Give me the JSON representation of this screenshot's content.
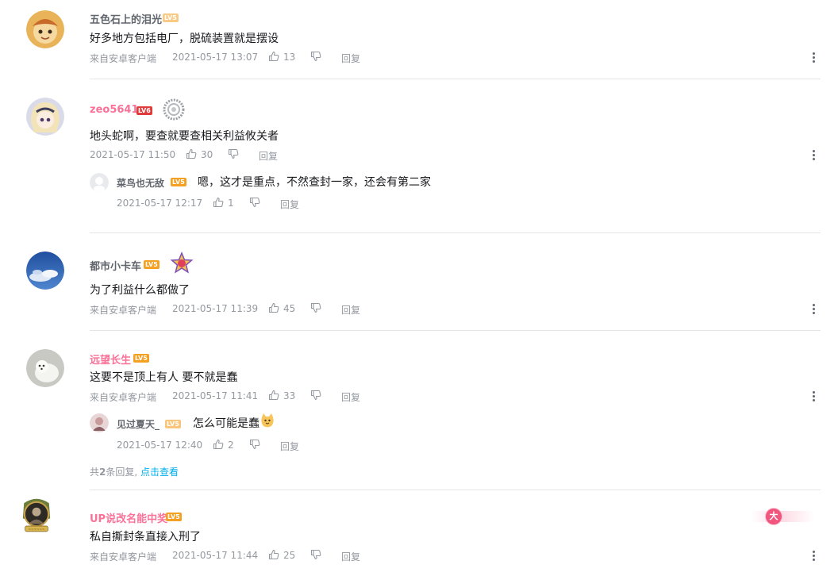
{
  "comments": [
    {
      "username": "五色石上的泪光",
      "level": "LV5",
      "text": "好多地方包括电厂，脱硫装置就是摆设",
      "source": "来自安卓客户端",
      "time": "2021-05-17 13:07",
      "likes": "13",
      "reply_label": "回复"
    },
    {
      "username": "zeo5641",
      "level": "LV6",
      "text": "地头蛇啊，要查就要查相关利益攸关者",
      "source": "",
      "time": "2021-05-17 11:50",
      "likes": "30",
      "reply_label": "回复",
      "sub_replies": [
        {
          "username": "菜鸟也无敌",
          "level": "LV5",
          "text": "嗯，这才是重点，不然查封一家，还会有第二家",
          "time": "2021-05-17 12:17",
          "likes": "1",
          "reply_label": "回复"
        }
      ]
    },
    {
      "username": "都市小卡车",
      "level": "LV5",
      "text": "为了利益什么都做了",
      "source": "来自安卓客户端",
      "time": "2021-05-17 11:39",
      "likes": "45",
      "reply_label": "回复"
    },
    {
      "username": "远望长生",
      "level": "LV5",
      "text": "这要不是顶上有人 要不就是蠢",
      "source": "来自安卓客户端",
      "time": "2021-05-17 11:41",
      "likes": "33",
      "reply_label": "回复",
      "sub_replies": [
        {
          "username": "见过夏天_",
          "level": "LV5",
          "text": "怎么可能是蠢",
          "time": "2021-05-17 12:40",
          "likes": "2",
          "reply_label": "回复"
        }
      ],
      "reply_summary_prefix": "共",
      "reply_summary_count": "2",
      "reply_summary_suffix": "条回复,",
      "reply_summary_link": "点击查看"
    },
    {
      "username": "UP说改名能中奖",
      "level": "LV5",
      "text": "私自撕封条直接入刑了",
      "source": "来自安卓客户端",
      "time": "2021-05-17 11:44",
      "likes": "25",
      "reply_label": "回复",
      "decoration_text": "大"
    }
  ],
  "colors": {
    "username_pink": "#fb7299",
    "username_default": "#61666d",
    "link_blue": "#00aeec",
    "level5": "#f4a023",
    "level6": "#e03c3c"
  },
  "icons": [
    "thumb-up-icon",
    "thumb-down-icon",
    "more-vertical-icon",
    "fan-medal-icon",
    "star-badge-icon",
    "emoji-icon"
  ]
}
